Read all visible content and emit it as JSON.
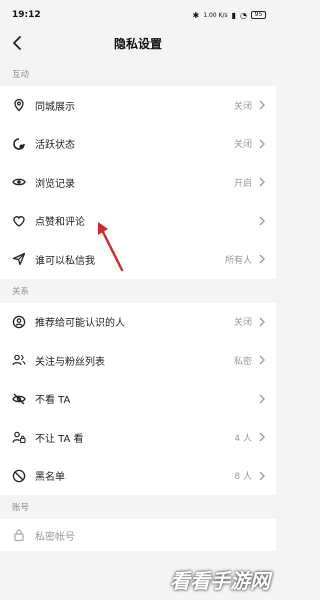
{
  "status_bar": {
    "time": "19:12",
    "net_speed": "1.00 K/s",
    "battery": "95"
  },
  "header": {
    "title": "隐私设置"
  },
  "sections": [
    {
      "title": "互动",
      "items": [
        {
          "label": "同城展示",
          "value": "关闭",
          "icon": "location-pin-icon"
        },
        {
          "label": "活跃状态",
          "value": "关闭",
          "icon": "activity-status-icon"
        },
        {
          "label": "浏览记录",
          "value": "开启",
          "icon": "eye-icon"
        },
        {
          "label": "点赞和评论",
          "value": "",
          "icon": "heart-icon"
        },
        {
          "label": "谁可以私信我",
          "value": "所有人",
          "icon": "send-icon"
        }
      ]
    },
    {
      "title": "关系",
      "items": [
        {
          "label": "推荐给可能认识的人",
          "value": "关闭",
          "icon": "user-circle-icon"
        },
        {
          "label": "关注与粉丝列表",
          "value": "私密",
          "icon": "users-icon"
        },
        {
          "label": "不看 TA",
          "value": "",
          "icon": "eye-off-icon"
        },
        {
          "label": "不让 TA 看",
          "value": "4 人",
          "icon": "user-lock-icon"
        },
        {
          "label": "黑名单",
          "value": "8 人",
          "icon": "block-icon"
        }
      ]
    },
    {
      "title": "账号",
      "items": [
        {
          "label": "私密帐号",
          "value": "",
          "icon": "lock-icon"
        }
      ]
    }
  ],
  "watermark": {
    "text": "看看手游网"
  },
  "colors": {
    "background": "#f4f4f5",
    "annotation_arrow": "#d9262b"
  }
}
